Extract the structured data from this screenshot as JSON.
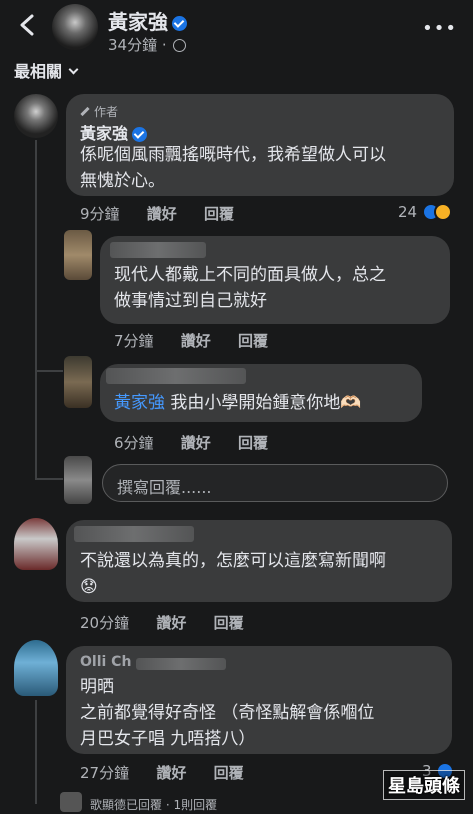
{
  "header": {
    "name": "黃家強",
    "time": "34分鐘",
    "separator": "·"
  },
  "sort_label": "最相關",
  "main_comment": {
    "author_tag": "作者",
    "name": "黃家強",
    "text": "係呢個風雨飄搖嘅時代，我希望做人可以\n無愧於心。",
    "time": "9分鐘",
    "like": "讚好",
    "reply": "回覆",
    "reaction_count": "24"
  },
  "replies": [
    {
      "text": "现代人都戴上不同的面具做人，总之\n做事情过到自己就好",
      "time": "7分鐘",
      "like": "讚好",
      "reply": "回覆"
    },
    {
      "mention": "黃家強",
      "text": " 我由小學開始鍾意你地🫶🏻",
      "time": "6分鐘",
      "like": "讚好",
      "reply": "回覆"
    }
  ],
  "reply_input_placeholder": "撰寫回覆......",
  "comment2": {
    "text": "不說還以為真的，怎麼可以這麼寫新聞啊\n😟",
    "time": "20分鐘",
    "like": "讚好",
    "reply": "回覆"
  },
  "comment3": {
    "name_partial": "Olli  Ch",
    "text": "明晒\n之前都覺得好奇怪 （奇怪點解會係嗰位\n月巴女子唱 九唔搭八）",
    "time": "27分鐘",
    "like": "讚好",
    "reply": "回覆",
    "reaction_count": "3"
  },
  "reply_summary": "歌顯德已回覆 · 1則回覆",
  "watermark": "星島頭條",
  "colors": {
    "background": "#18191a",
    "bubble": "#3a3b3c",
    "link": "#4599ff",
    "verified": "#1b74e4"
  }
}
